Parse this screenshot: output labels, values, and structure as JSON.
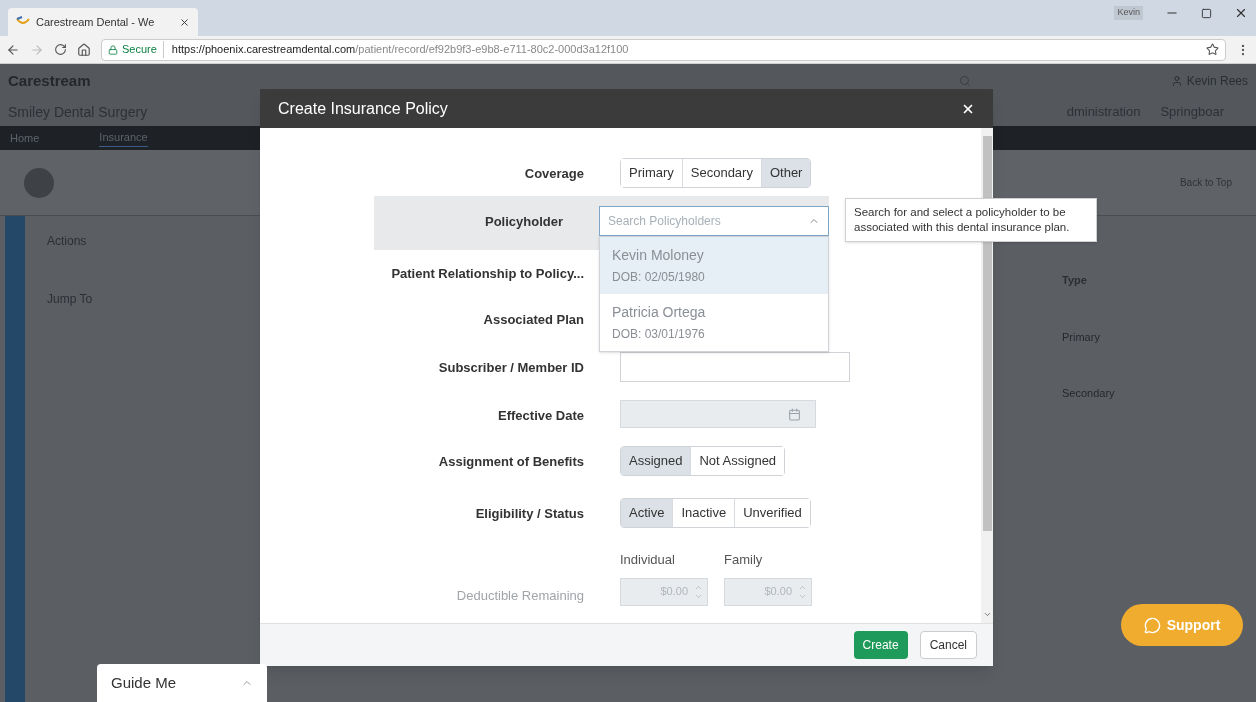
{
  "browser": {
    "tab_title": "Carestream Dental - We",
    "secure": "Secure",
    "url_host": "https://phoenix.carestreamdental.com",
    "url_path": "/patient/record/ef92b9f3-e9b8-e711-80c2-000d3a12f100",
    "os_user": "Kevin"
  },
  "app": {
    "logo": "Carestream",
    "user": "Kevin Rees",
    "tabs": [
      {
        "label": "Smiley Dental Surgery"
      },
      {
        "label": "dministration"
      },
      {
        "label": "Springboar"
      }
    ],
    "nav": [
      {
        "label": "Home",
        "selected": false
      },
      {
        "label": "Insurance",
        "selected": true
      }
    ],
    "sidebar": {
      "sections": [
        "Actions",
        "Jump To"
      ]
    },
    "back_to_top": "Back to Top",
    "table": {
      "column": "Type",
      "rows": [
        "Primary",
        "Secondary"
      ]
    }
  },
  "modal": {
    "title": "Create Insurance Policy",
    "fields": [
      {
        "kind": "segmented",
        "label": "Coverage",
        "options": [
          {
            "label": "Primary",
            "selected": false
          },
          {
            "label": "Secondary",
            "selected": false
          },
          {
            "label": "Other",
            "selected": true
          }
        ]
      },
      {
        "kind": "select",
        "label": "Policyholder",
        "highlighted": true,
        "placeholder": "Search Policyholders",
        "expanded": true,
        "options": [
          {
            "name": "Kevin Moloney",
            "dob": "DOB: 02/05/1980",
            "selected": true
          },
          {
            "name": "Patricia Ortega",
            "dob": "DOB: 03/01/1976",
            "selected": false
          }
        ],
        "help": "Search for and select a policyholder to be associated with this dental insurance plan."
      },
      {
        "kind": "plain",
        "label": "Patient Relationship to Policy..."
      },
      {
        "kind": "plain",
        "label": "Associated Plan"
      },
      {
        "kind": "text",
        "label": "Subscriber / Member ID"
      },
      {
        "kind": "date",
        "label": "Effective Date",
        "disabled": true
      },
      {
        "kind": "segmented",
        "label": "Assignment of Benefits",
        "options": [
          {
            "label": "Assigned",
            "selected": true
          },
          {
            "label": "Not Assigned",
            "selected": false
          }
        ]
      },
      {
        "kind": "segmented",
        "label": "Eligibility / Status",
        "options": [
          {
            "label": "Active",
            "selected": true
          },
          {
            "label": "Inactive",
            "selected": false
          },
          {
            "label": "Unverified",
            "selected": false
          }
        ]
      },
      {
        "kind": "amounts",
        "label": "Deductible Remaining",
        "disabled": true,
        "columns": [
          {
            "heading": "Individual",
            "value": "$0.00"
          },
          {
            "heading": "Family",
            "value": "$0.00"
          }
        ]
      }
    ],
    "buttons": [
      {
        "label": "Create",
        "kind": "primary"
      },
      {
        "label": "Cancel",
        "kind": "secondary"
      }
    ]
  },
  "guide": {
    "label": "Guide Me"
  },
  "support": {
    "label": "Support"
  }
}
